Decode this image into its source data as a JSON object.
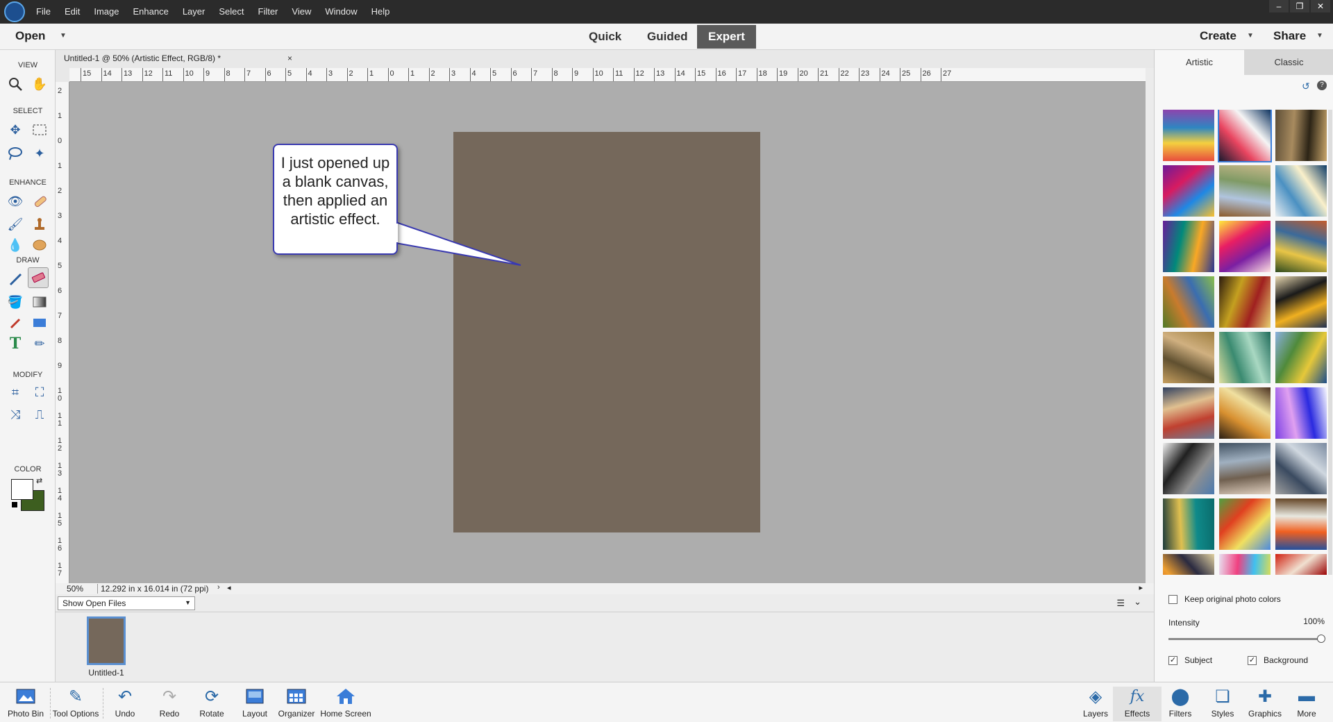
{
  "menubar": {
    "items": [
      "File",
      "Edit",
      "Image",
      "Enhance",
      "Layer",
      "Select",
      "Filter",
      "View",
      "Window",
      "Help"
    ],
    "window_controls": [
      "–",
      "❐",
      "✕"
    ]
  },
  "modebar": {
    "open_label": "Open",
    "modes": [
      "Quick",
      "Guided",
      "Expert"
    ],
    "active_mode": "Expert",
    "create_label": "Create",
    "share_label": "Share"
  },
  "toolbox": {
    "sections": [
      "VIEW",
      "SELECT",
      "ENHANCE",
      "DRAW",
      "MODIFY",
      "COLOR"
    ]
  },
  "document": {
    "tab_title": "Untitled-1 @ 50% (Artistic Effect, RGB/8) *",
    "tab_close": "×",
    "canvas_color": "#75685b",
    "zoom": "50%",
    "doc_info": "12.292 in x 16.014 in (72 ppi)"
  },
  "ruler": {
    "horizontal": [
      "15",
      "14",
      "13",
      "12",
      "11",
      "10",
      "9",
      "8",
      "7",
      "6",
      "5",
      "4",
      "3",
      "2",
      "1",
      "0",
      "1",
      "2",
      "3",
      "4",
      "5",
      "6",
      "7",
      "8",
      "9",
      "10",
      "11",
      "12",
      "13",
      "14",
      "15",
      "16",
      "17",
      "18",
      "19",
      "20",
      "21",
      "22",
      "23",
      "24",
      "25",
      "26",
      "27"
    ],
    "vertical": [
      "2",
      "1",
      "0",
      "1",
      "2",
      "3",
      "4",
      "5",
      "6",
      "7",
      "8",
      "9",
      "1\n0",
      "1\n1",
      "1\n2",
      "1\n3",
      "1\n4",
      "1\n5",
      "1\n6",
      "1\n7"
    ]
  },
  "callout": {
    "text": "I just opened up a blank canvas, then applied an artistic effect."
  },
  "photobin": {
    "dropdown": "Show Open Files",
    "thumb_label": "Untitled-1"
  },
  "rpanel": {
    "tabs": [
      "Artistic",
      "Classic"
    ],
    "active_tab": "Artistic",
    "keep_colors_label": "Keep original photo colors",
    "intensity_label": "Intensity",
    "intensity_value": "100%",
    "intensity_fraction": 1.0,
    "subject_label": "Subject",
    "background_label": "Background",
    "subject_checked": true,
    "background_checked": true
  },
  "taskbar": {
    "left": [
      "Photo Bin",
      "Tool Options",
      "Undo",
      "Redo",
      "Rotate",
      "Layout",
      "Organizer",
      "Home Screen"
    ],
    "right": [
      "Layers",
      "Effects",
      "Filters",
      "Styles",
      "Graphics",
      "More"
    ]
  }
}
